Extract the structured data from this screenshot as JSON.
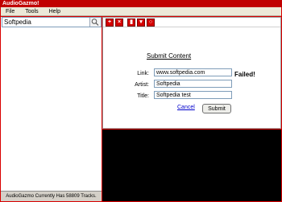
{
  "window": {
    "title": "AudioGazmo!"
  },
  "menu": {
    "items": [
      "File",
      "Tools",
      "Help"
    ]
  },
  "search": {
    "value": "Softpedia"
  },
  "status": {
    "text": "AudioGazmo Currently Has 58809 Tracks."
  },
  "toolbar": {
    "icons": [
      "add-icon",
      "close-icon",
      "delete-icon",
      "download-icon",
      "refresh-icon"
    ]
  },
  "form": {
    "title": "Submit Content",
    "link_label": "Link:",
    "link_value": "www.softpedia.com",
    "artist_label": "Artist:",
    "artist_value": "Softpedia",
    "title_label": "Title:",
    "title_value": "Softpedia test",
    "result": "Failed!",
    "cancel_label": "Cancel",
    "submit_label": "Submit"
  },
  "colors": {
    "frame": "#d90000",
    "player": "#000000"
  }
}
